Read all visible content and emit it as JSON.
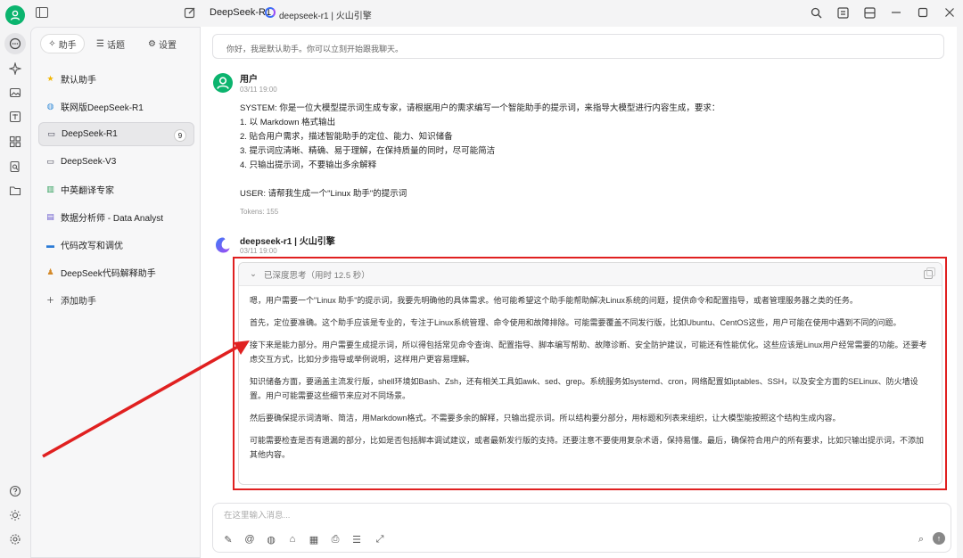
{
  "titlebar": {
    "model": "DeepSeek-R1",
    "provider": "deepseek-r1 | 火山引擎"
  },
  "panel": {
    "tabs": [
      {
        "label": "助手",
        "icon": "sparkle-icon"
      },
      {
        "label": "话题",
        "icon": "list-icon"
      },
      {
        "label": "设置",
        "icon": "gear-icon"
      }
    ],
    "assistants": [
      {
        "label": "默认助手",
        "icon": "star-emoji"
      },
      {
        "label": "联网版DeepSeek-R1",
        "icon": "globe-emoji"
      },
      {
        "label": "DeepSeek-R1",
        "icon": "computer-emoji",
        "badge": "9"
      },
      {
        "label": "DeepSeek-V3",
        "icon": "computer-emoji"
      },
      {
        "label": "中英翻译专家",
        "icon": "books-emoji"
      },
      {
        "label": "数据分析师 - Data Analyst",
        "icon": "chart-emoji"
      },
      {
        "label": "代码改写和调优",
        "icon": "monitor-emoji"
      },
      {
        "label": "DeepSeek代码解释助手",
        "icon": "person-emoji"
      }
    ],
    "add_label": "添加助手"
  },
  "greeting": "你好，我是默认助手。你可以立刻开始跟我聊天。",
  "user_msg": {
    "name": "用户",
    "time": "03/11 19:00",
    "lines": [
      "SYSTEM: 你是一位大模型提示词生成专家，请根据用户的需求编写一个智能助手的提示词，来指导大模型进行内容生成，要求：",
      "1. 以 Markdown 格式输出",
      "2. 贴合用户需求，描述智能助手的定位、能力、知识储备",
      "3. 提示词应清晰、精确、易于理解，在保持质量的同时，尽可能简洁",
      "4. 只输出提示词，不要输出多余解释",
      "",
      "USER: 请帮我生成一个\"Linux 助手\"的提示词"
    ],
    "tokens": "Tokens: 155"
  },
  "bot_msg": {
    "name": "deepseek-r1 | 火山引擎",
    "time": "03/11 19:00",
    "think_header": "已深度思考（用时 12.5 秒）",
    "paragraphs": [
      "嗯，用户需要一个\"Linux 助手\"的提示词，我要先明确他的具体需求。他可能希望这个助手能帮助解决Linux系统的问题，提供命令和配置指导，或者管理服务器之类的任务。",
      "首先，定位要准确。这个助手应该是专业的，专注于Linux系统管理、命令使用和故障排除。可能需要覆盖不同发行版，比如Ubuntu、CentOS这些，用户可能在使用中遇到不同的问题。",
      "接下来是能力部分。用户需要生成提示词，所以得包括常见命令查询、配置指导、脚本编写帮助、故障诊断、安全防护建议，可能还有性能优化。这些应该是Linux用户经常需要的功能。还要考虑交互方式，比如分步指导或举例说明，这样用户更容易理解。",
      "知识储备方面，要涵盖主流发行版，shell环境如Bash、Zsh，还有相关工具如awk、sed、grep。系统服务如systemd、cron，网络配置如iptables、SSH，以及安全方面的SELinux、防火墙设置。用户可能需要这些细节来应对不同场景。",
      "然后要确保提示词清晰、简洁，用Markdown格式。不需要多余的解释，只输出提示词。所以结构要分部分，用标题和列表来组织，让大模型能按照这个结构生成内容。",
      "可能需要检查是否有遗漏的部分，比如是否包括脚本调试建议，或者最新发行版的支持。还要注意不要使用复杂术语，保持易懂。最后，确保符合用户的所有要求，比如只输出提示词，不添加其他内容。"
    ]
  },
  "input": {
    "placeholder": "在这里输入消息..."
  },
  "colors": {
    "accent_green": "#0bb46e",
    "highlight_red": "#e02020"
  }
}
